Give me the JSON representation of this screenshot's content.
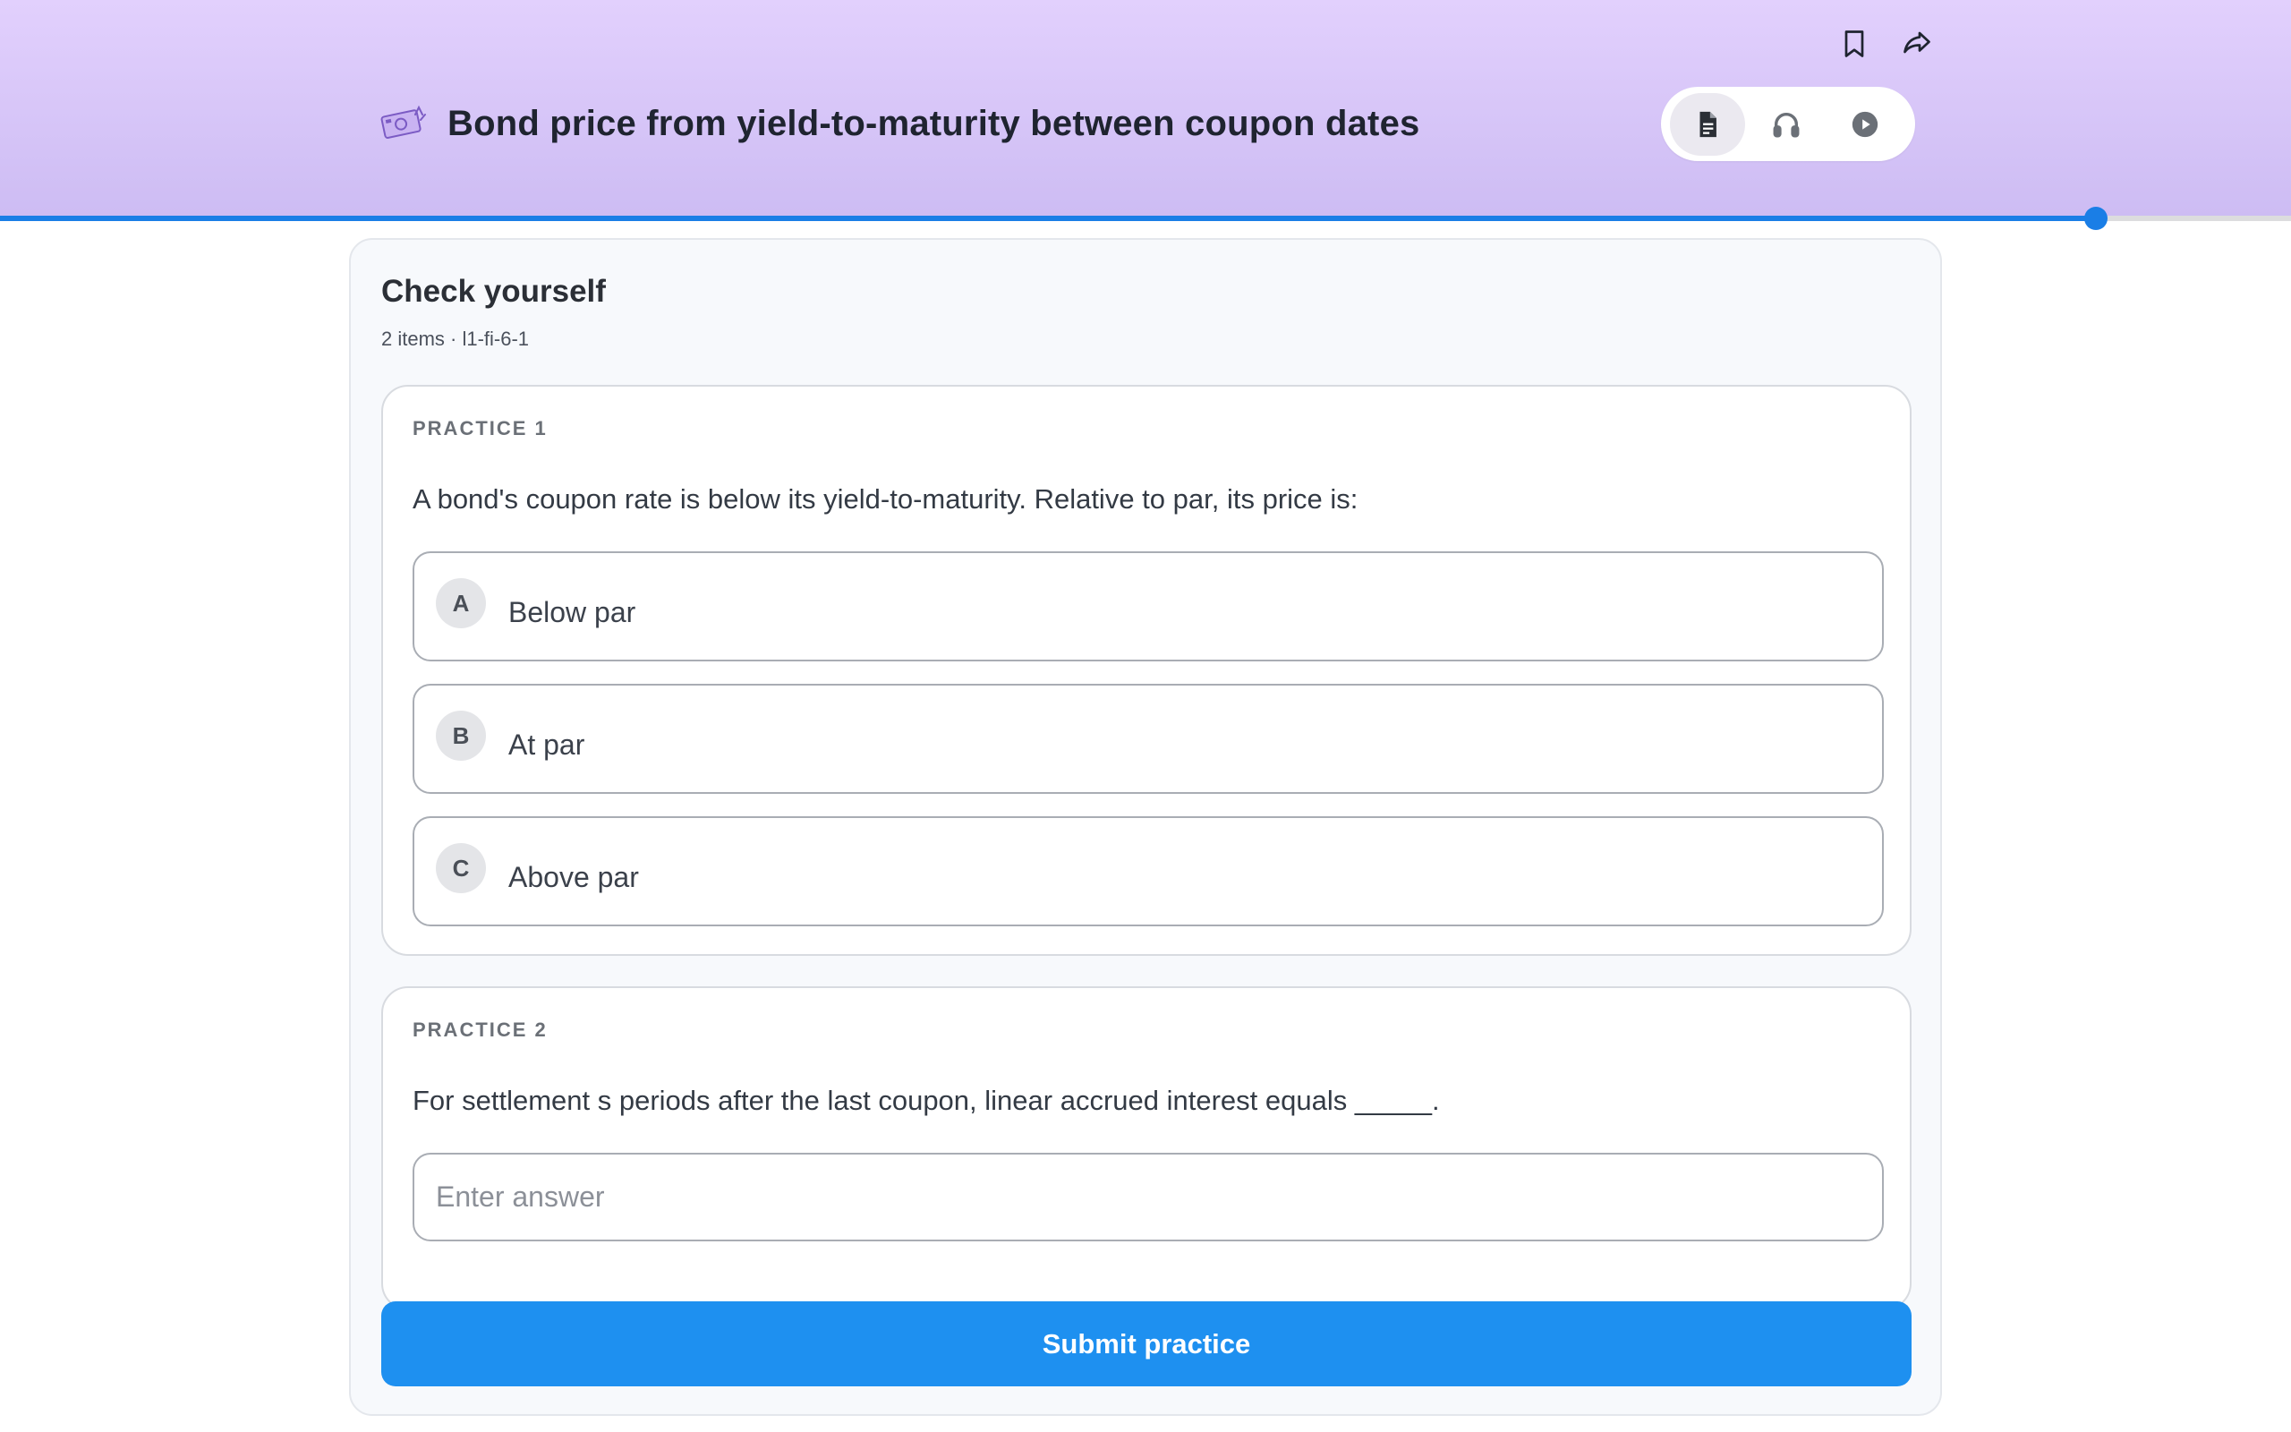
{
  "header": {
    "title": "Bond price from yield-to-maturity between coupon dates",
    "lesson_icon": "money-icon",
    "actions": [
      {
        "name": "bookmark-icon"
      },
      {
        "name": "share-icon"
      }
    ],
    "modes": [
      {
        "name": "document-icon",
        "active": true
      },
      {
        "name": "headphones-icon",
        "active": false
      },
      {
        "name": "play-icon",
        "active": false
      }
    ],
    "progress": 0.915
  },
  "panel": {
    "title": "Check yourself",
    "meta": "2 items · l1-fi-6-1"
  },
  "practices": [
    {
      "label": "PRACTICE 1",
      "question": "A bond's coupon rate is below its yield-to-maturity. Relative to par, its price is:",
      "options": [
        {
          "letter": "A",
          "text": "Below par"
        },
        {
          "letter": "B",
          "text": "At par"
        },
        {
          "letter": "C",
          "text": "Above par"
        }
      ]
    },
    {
      "label": "PRACTICE 2",
      "question": "For settlement s periods after the last coupon, linear accrued interest equals _____.",
      "input_placeholder": "Enter answer",
      "input_value": ""
    }
  ],
  "submit_label": "Submit practice",
  "colors": {
    "accent": "#1e90f0",
    "progress": "#1a7ee6",
    "header_top": "#e2d0fd",
    "header_bottom": "#cdbcf3"
  }
}
